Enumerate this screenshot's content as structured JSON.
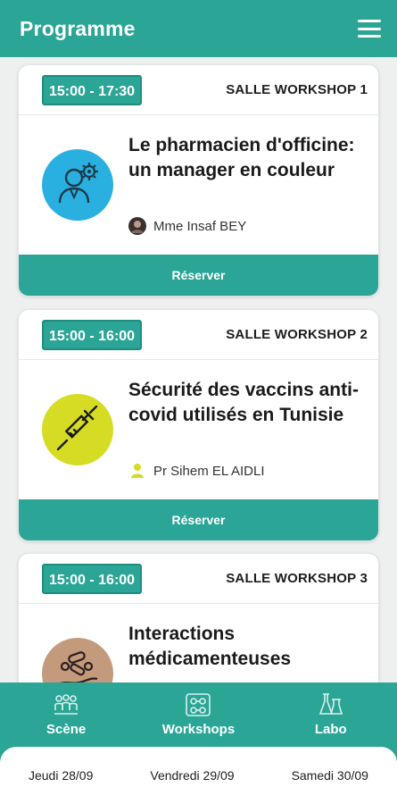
{
  "header": {
    "title": "Programme",
    "menu_icon": "menu-icon"
  },
  "sessions": [
    {
      "time": "15:00 - 17:30",
      "room": "SALLE WORKSHOP 1",
      "title": "Le pharmacien d'officine: un manager en couleur",
      "speaker": "Mme Insaf BEY",
      "icon": "manager-gear-icon",
      "icon_bg": "#2ab0e0",
      "reserve_label": "Réserver"
    },
    {
      "time": "15:00 - 16:00",
      "room": "SALLE WORKSHOP 2",
      "title": "Sécurité des vaccins anti-covid utilisés en Tunisie",
      "speaker": "Pr Sihem EL AIDLI",
      "icon": "syringe-icon",
      "icon_bg": "#d6dc24",
      "reserve_label": "Réserver"
    },
    {
      "time": "15:00 - 16:00",
      "room": "SALLE WORKSHOP 3",
      "title": "Interactions médicamenteuses",
      "icon": "pills-hand-icon",
      "icon_bg": "#c49a7c"
    }
  ],
  "bottom_nav": {
    "tabs": [
      {
        "label": "Scène",
        "icon": "audience-icon"
      },
      {
        "label": "Workshops",
        "icon": "workshops-icon"
      },
      {
        "label": "Labo",
        "icon": "flask-icon"
      }
    ],
    "days": [
      "Jeudi 28/09",
      "Vendredi 29/09",
      "Samedi 30/09"
    ]
  },
  "colors": {
    "primary": "#2aa596",
    "primary_dark": "#1e8d80",
    "speaker_icon": "#d6dc24"
  }
}
